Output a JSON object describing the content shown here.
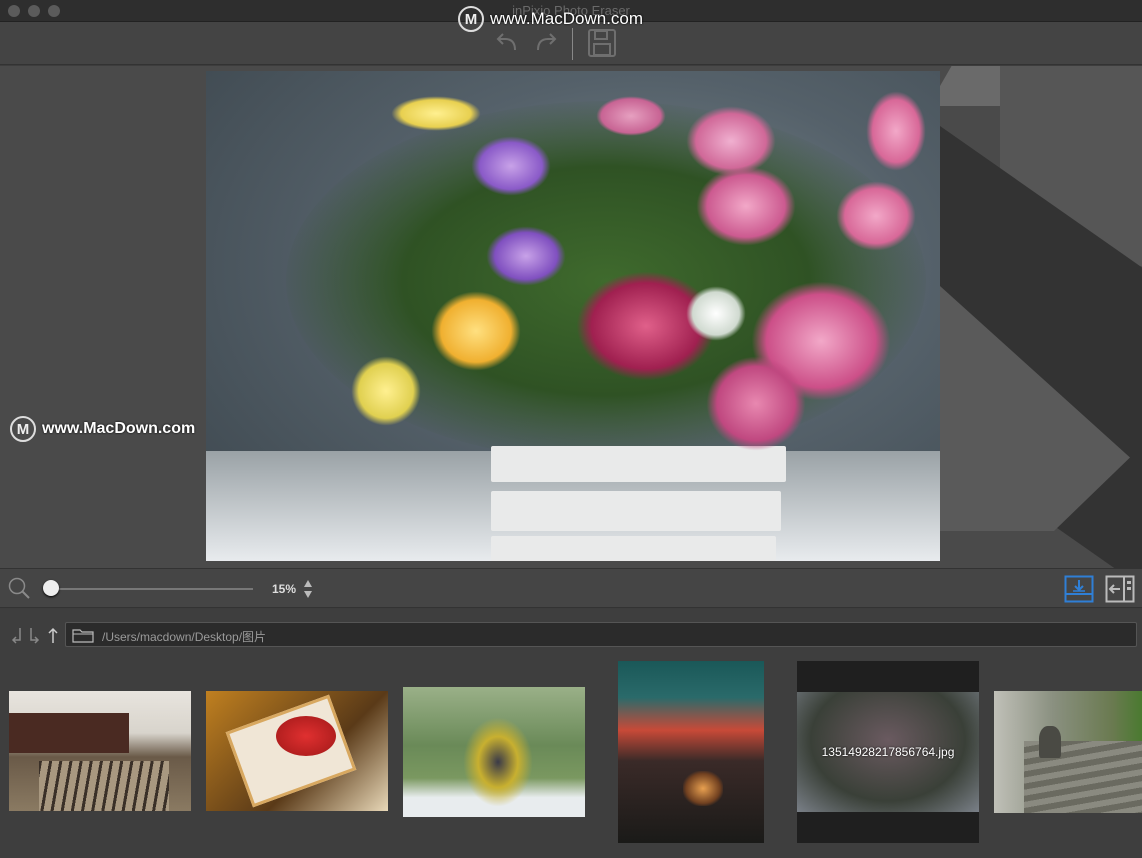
{
  "window": {
    "title": "inPixio Photo Eraser"
  },
  "watermark": {
    "text": "www.MacDown.com",
    "logo_letter": "M"
  },
  "toolbar": {
    "undo_icon": "undo-icon",
    "redo_icon": "redo-icon",
    "save_icon": "save-icon"
  },
  "zoom": {
    "value": "15%",
    "level_fraction": 0.0
  },
  "browser": {
    "path": "/Users/macdown/Desktop/图片",
    "thumbnails": [
      {
        "id": "train-tracks",
        "caption": ""
      },
      {
        "id": "gift-box",
        "caption": ""
      },
      {
        "id": "kids-playing",
        "caption": ""
      },
      {
        "id": "sunset-jar",
        "caption": ""
      },
      {
        "id": "flower-vase",
        "caption": "13514928217856764.jpg"
      },
      {
        "id": "alley-path",
        "caption": ""
      }
    ]
  },
  "colors": {
    "accent": "#2f7fd6",
    "background": "#3d3d3d"
  }
}
